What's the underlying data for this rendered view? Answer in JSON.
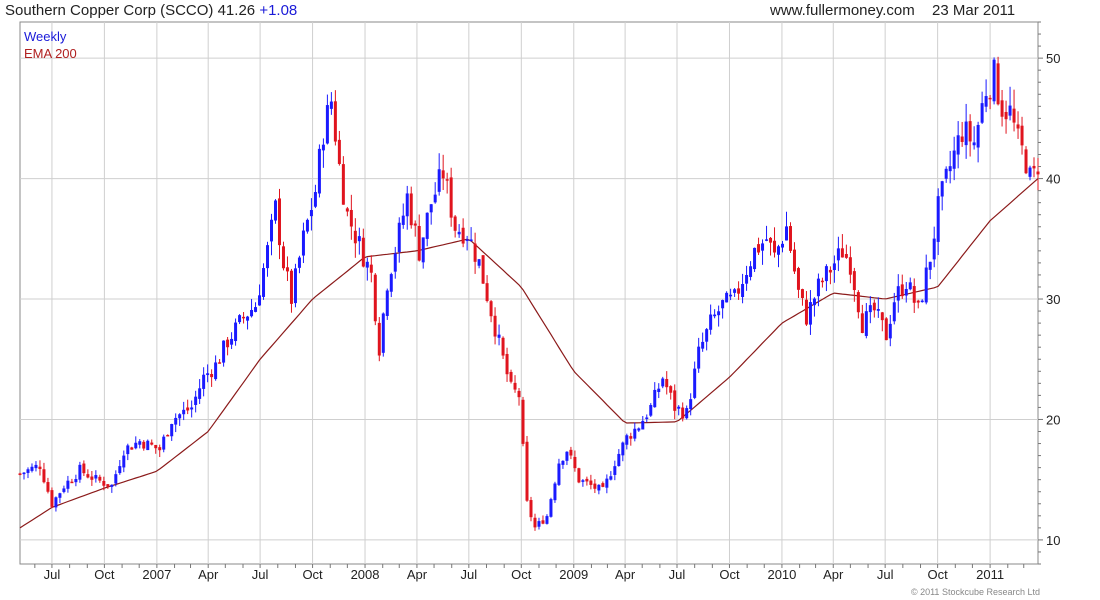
{
  "header": {
    "company": "Southern Copper Corp (SCCO)",
    "price": "41.26",
    "change": "+1.08",
    "site": "www.fullermoney.com",
    "date": "23 Mar 2011"
  },
  "legend": {
    "weekly_label": "Weekly",
    "ema_label": "EMA 200"
  },
  "footer": {
    "copyright": "© 2011 Stockcube Research Ltd"
  },
  "colors": {
    "up": "#1a1aff",
    "down": "#e0141e",
    "ema": "#8b1a1a",
    "grid": "#cfcfcf",
    "change": "#1a1ad8"
  },
  "chart_data": {
    "type": "candlestick",
    "y_range": [
      8,
      53
    ],
    "y_ticks": [
      10,
      20,
      30,
      40,
      50
    ],
    "x_range": [
      "2006-05-06",
      "2011-03-26"
    ],
    "x_ticks": [
      {
        "date": "2006-07-01",
        "label": "Jul"
      },
      {
        "date": "2006-10-01",
        "label": "Oct"
      },
      {
        "date": "2007-01-01",
        "label": "2007"
      },
      {
        "date": "2007-04-01",
        "label": "Apr"
      },
      {
        "date": "2007-07-01",
        "label": "Jul"
      },
      {
        "date": "2007-10-01",
        "label": "Oct"
      },
      {
        "date": "2008-01-01",
        "label": "2008"
      },
      {
        "date": "2008-04-01",
        "label": "Apr"
      },
      {
        "date": "2008-07-01",
        "label": "Jul"
      },
      {
        "date": "2008-10-01",
        "label": "Oct"
      },
      {
        "date": "2009-01-01",
        "label": "2009"
      },
      {
        "date": "2009-04-01",
        "label": "Apr"
      },
      {
        "date": "2009-07-01",
        "label": "Jul"
      },
      {
        "date": "2009-10-01",
        "label": "Oct"
      },
      {
        "date": "2010-01-01",
        "label": "2010"
      },
      {
        "date": "2010-04-01",
        "label": "Apr"
      },
      {
        "date": "2010-07-01",
        "label": "Jul"
      },
      {
        "date": "2010-10-01",
        "label": "Oct"
      },
      {
        "date": "2011-01-01",
        "label": "2011"
      }
    ],
    "close_anchors": [
      [
        "2006-05-06",
        15.5
      ],
      [
        "2006-06-10",
        16.2
      ],
      [
        "2006-07-01",
        13.0
      ],
      [
        "2006-07-22",
        14.5
      ],
      [
        "2006-08-19",
        15.8
      ],
      [
        "2006-09-16",
        15.0
      ],
      [
        "2006-10-14",
        14.5
      ],
      [
        "2006-11-04",
        17.5
      ],
      [
        "2006-12-02",
        18.2
      ],
      [
        "2007-01-06",
        17.5
      ],
      [
        "2007-01-27",
        20.0
      ],
      [
        "2007-03-03",
        21.0
      ],
      [
        "2007-03-24",
        23.5
      ],
      [
        "2007-04-14",
        24.5
      ],
      [
        "2007-05-05",
        26.5
      ],
      [
        "2007-06-02",
        28.5
      ],
      [
        "2007-06-23",
        29.5
      ],
      [
        "2007-07-14",
        34.0
      ],
      [
        "2007-07-28",
        37.5
      ],
      [
        "2007-08-11",
        33.0
      ],
      [
        "2007-08-25",
        30.0
      ],
      [
        "2007-09-15",
        35.0
      ],
      [
        "2007-10-06",
        39.0
      ],
      [
        "2007-10-20",
        44.0
      ],
      [
        "2007-11-03",
        46.5
      ],
      [
        "2007-11-17",
        41.0
      ],
      [
        "2007-12-01",
        37.0
      ],
      [
        "2007-12-22",
        34.5
      ],
      [
        "2008-01-12",
        32.0
      ],
      [
        "2008-01-26",
        26.0
      ],
      [
        "2008-02-09",
        31.5
      ],
      [
        "2008-03-01",
        35.5
      ],
      [
        "2008-03-15",
        38.5
      ],
      [
        "2008-04-05",
        34.0
      ],
      [
        "2008-04-26",
        38.0
      ],
      [
        "2008-05-17",
        40.5
      ],
      [
        "2008-06-07",
        36.0
      ],
      [
        "2008-06-28",
        35.5
      ],
      [
        "2008-07-19",
        33.0
      ],
      [
        "2008-08-09",
        29.0
      ],
      [
        "2008-08-30",
        25.0
      ],
      [
        "2008-09-13",
        22.5
      ],
      [
        "2008-09-27",
        22.0
      ],
      [
        "2008-10-11",
        13.0
      ],
      [
        "2008-10-25",
        11.0
      ],
      [
        "2008-11-15",
        12.0
      ],
      [
        "2008-12-06",
        16.5
      ],
      [
        "2008-12-20",
        17.5
      ],
      [
        "2009-01-10",
        15.0
      ],
      [
        "2009-01-31",
        14.5
      ],
      [
        "2009-02-21",
        14.0
      ],
      [
        "2009-03-14",
        16.5
      ],
      [
        "2009-04-04",
        18.5
      ],
      [
        "2009-04-25",
        19.5
      ],
      [
        "2009-05-16",
        21.0
      ],
      [
        "2009-06-06",
        23.5
      ],
      [
        "2009-06-27",
        21.0
      ],
      [
        "2009-07-18",
        20.5
      ],
      [
        "2009-08-08",
        25.5
      ],
      [
        "2009-08-29",
        28.0
      ],
      [
        "2009-09-19",
        29.5
      ],
      [
        "2009-10-10",
        30.0
      ],
      [
        "2009-10-31",
        32.5
      ],
      [
        "2009-11-14",
        34.0
      ],
      [
        "2009-12-05",
        35.0
      ],
      [
        "2009-12-19",
        33.5
      ],
      [
        "2010-01-09",
        36.0
      ],
      [
        "2010-01-30",
        30.5
      ],
      [
        "2010-02-13",
        28.5
      ],
      [
        "2010-03-06",
        31.0
      ],
      [
        "2010-03-27",
        32.5
      ],
      [
        "2010-04-17",
        34.0
      ],
      [
        "2010-05-01",
        33.0
      ],
      [
        "2010-05-22",
        28.0
      ],
      [
        "2010-06-12",
        29.0
      ],
      [
        "2010-07-03",
        27.0
      ],
      [
        "2010-07-17",
        30.0
      ],
      [
        "2010-08-07",
        31.5
      ],
      [
        "2010-08-28",
        29.0
      ],
      [
        "2010-09-18",
        33.5
      ],
      [
        "2010-10-02",
        37.5
      ],
      [
        "2010-10-23",
        41.0
      ],
      [
        "2010-11-13",
        44.0
      ],
      [
        "2010-12-04",
        43.0
      ],
      [
        "2010-12-25",
        47.5
      ],
      [
        "2011-01-08",
        48.5
      ],
      [
        "2011-01-22",
        46.0
      ],
      [
        "2011-02-05",
        45.5
      ],
      [
        "2011-02-19",
        43.0
      ],
      [
        "2011-03-05",
        41.5
      ],
      [
        "2011-03-12",
        40.0
      ],
      [
        "2011-03-19",
        40.2
      ],
      [
        "2011-03-26",
        41.26
      ]
    ],
    "ema_anchors": [
      [
        "2006-05-06",
        11.0
      ],
      [
        "2006-07-01",
        12.7
      ],
      [
        "2006-10-01",
        14.3
      ],
      [
        "2007-01-01",
        15.7
      ],
      [
        "2007-04-01",
        19.0
      ],
      [
        "2007-07-01",
        25.0
      ],
      [
        "2007-10-01",
        30.0
      ],
      [
        "2008-01-01",
        33.5
      ],
      [
        "2008-04-01",
        34.0
      ],
      [
        "2008-07-01",
        35.0
      ],
      [
        "2008-10-01",
        31.0
      ],
      [
        "2009-01-01",
        24.0
      ],
      [
        "2009-04-01",
        19.7
      ],
      [
        "2009-07-01",
        19.8
      ],
      [
        "2009-10-01",
        23.5
      ],
      [
        "2010-01-01",
        28.0
      ],
      [
        "2010-04-01",
        30.5
      ],
      [
        "2010-07-01",
        30.0
      ],
      [
        "2010-10-01",
        31.0
      ],
      [
        "2011-01-01",
        36.5
      ],
      [
        "2011-03-26",
        40.0
      ]
    ]
  }
}
